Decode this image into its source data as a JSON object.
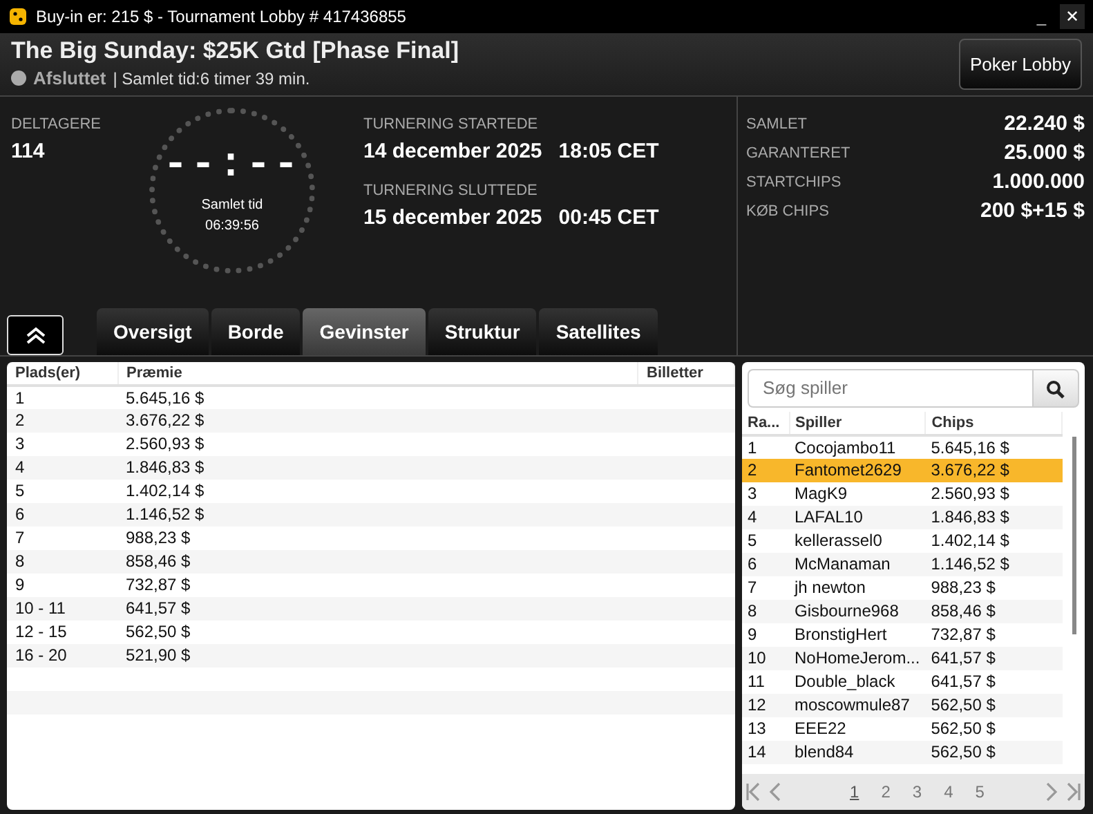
{
  "window": {
    "title": "Buy-in er: 215 $ - Tournament Lobby # 417436855",
    "controls": [
      "_",
      "✕"
    ]
  },
  "header": {
    "title": "The Big Sunday: $25K Gtd [Phase Final]",
    "status": "Afsluttet",
    "duration": "| Samlet tid:6 timer   39 min.",
    "lobby_button": "Poker Lobby"
  },
  "participants": {
    "label": "DELTAGERE",
    "value": "114"
  },
  "clock": {
    "display": "--:--",
    "label": "Samlet tid",
    "time": "06:39:56"
  },
  "dates": [
    {
      "label": "TURNERING STARTEDE",
      "date": "14 december 2025",
      "time": "18:05 CET"
    },
    {
      "label": "TURNERING SLUTTEDE",
      "date": "15 december 2025",
      "time": "00:45 CET"
    }
  ],
  "stats": [
    {
      "label": "SAMLET",
      "value": "22.240 $"
    },
    {
      "label": "GARANTERET",
      "value": "25.000 $"
    },
    {
      "label": "STARTCHIPS",
      "value": "1.000.000"
    },
    {
      "label": "KØB CHIPS",
      "value": "200 $+15 $"
    }
  ],
  "tabs": [
    {
      "label": "Oversigt",
      "selected": false
    },
    {
      "label": "Borde",
      "selected": false
    },
    {
      "label": "Gevinster",
      "selected": true
    },
    {
      "label": "Struktur",
      "selected": false
    },
    {
      "label": "Satellites",
      "selected": false
    }
  ],
  "prizes": {
    "columns": [
      "Plads(er)",
      "Præmie",
      "Billetter"
    ],
    "rows": [
      [
        "1",
        "5.645,16 $"
      ],
      [
        "2",
        "3.676,22 $"
      ],
      [
        "3",
        "2.560,93 $"
      ],
      [
        "4",
        "1.846,83 $"
      ],
      [
        "5",
        "1.402,14 $"
      ],
      [
        "6",
        "1.146,52 $"
      ],
      [
        "7",
        "988,23 $"
      ],
      [
        "8",
        "858,46 $"
      ],
      [
        "9",
        "732,87 $"
      ],
      [
        "10 - 11",
        "641,57 $"
      ],
      [
        "12 - 15",
        "562,50 $"
      ],
      [
        "16 - 20",
        "521,90 $"
      ]
    ]
  },
  "players": {
    "search": {
      "placeholder": "Søg spiller"
    },
    "columns": [
      "Ra...",
      "Spiller",
      "Chips"
    ],
    "rows": [
      {
        "rank": "1",
        "name": "Cocojambo11",
        "chips": "5.645,16 $",
        "selected": false
      },
      {
        "rank": "2",
        "name": "Fantomet2629",
        "chips": "3.676,22 $",
        "selected": true
      },
      {
        "rank": "3",
        "name": "MagK9",
        "chips": "2.560,93 $",
        "selected": false
      },
      {
        "rank": "4",
        "name": "LAFAL10",
        "chips": "1.846,83 $",
        "selected": false
      },
      {
        "rank": "5",
        "name": "kellerassel0",
        "chips": "1.402,14 $",
        "selected": false
      },
      {
        "rank": "6",
        "name": "McManaman",
        "chips": "1.146,52 $",
        "selected": false
      },
      {
        "rank": "7",
        "name": "jh newton",
        "chips": "988,23 $",
        "selected": false
      },
      {
        "rank": "8",
        "name": "Gisbourne968",
        "chips": "858,46 $",
        "selected": false
      },
      {
        "rank": "9",
        "name": "BronstigHert",
        "chips": "732,87 $",
        "selected": false
      },
      {
        "rank": "10",
        "name": "NoHomeJerom...",
        "chips": "641,57 $",
        "selected": false
      },
      {
        "rank": "11",
        "name": "Double_black",
        "chips": "641,57 $",
        "selected": false
      },
      {
        "rank": "12",
        "name": "moscowmule87",
        "chips": "562,50 $",
        "selected": false
      },
      {
        "rank": "13",
        "name": "EEE22",
        "chips": "562,50 $",
        "selected": false
      },
      {
        "rank": "14",
        "name": "blend84",
        "chips": "562,50 $",
        "selected": false
      }
    ],
    "pages": [
      {
        "label": "1",
        "selected": true
      },
      {
        "label": "2",
        "selected": false
      },
      {
        "label": "3",
        "selected": false
      },
      {
        "label": "4",
        "selected": false
      },
      {
        "label": "5",
        "selected": false
      }
    ]
  }
}
